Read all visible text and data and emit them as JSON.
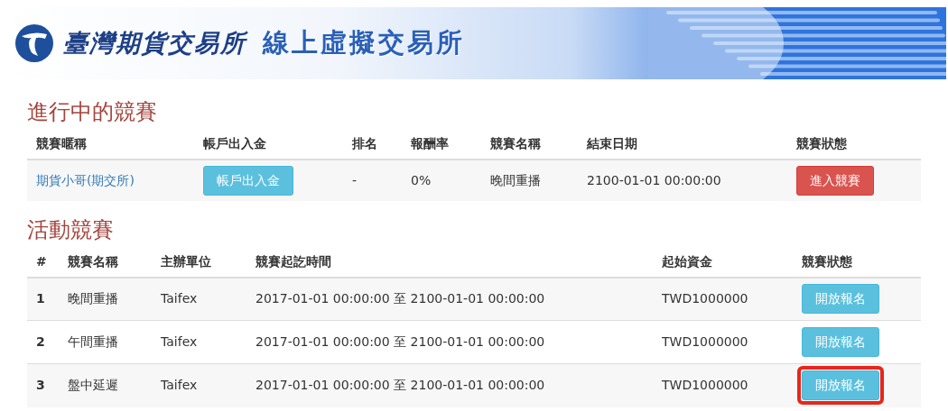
{
  "banner": {
    "logo_text": "臺灣期貨交易所",
    "title": "線上虛擬交易所"
  },
  "current": {
    "heading": "進行中的競賽",
    "columns": [
      "競賽暱稱",
      "帳戶出入金",
      "排名",
      "報酬率",
      "競賽名稱",
      "結束日期",
      "競賽狀態"
    ],
    "rows": [
      {
        "nickname": "期貨小哥(期交所)",
        "funds_button": "帳戶出入金",
        "rank": "-",
        "return": "0%",
        "name": "晚間重播",
        "end": "2100-01-01 00:00:00",
        "status_button": "進入競賽"
      }
    ]
  },
  "activities": {
    "heading": "活動競賽",
    "columns": [
      "#",
      "競賽名稱",
      "主辦單位",
      "競賽起訖時間",
      "起始資金",
      "競賽狀態"
    ],
    "rows": [
      {
        "no": "1",
        "name": "晚間重播",
        "organizer": "Taifex",
        "period": "2017-01-01 00:00:00 至 2100-01-01 00:00:00",
        "capital": "TWD1000000",
        "status_button": "開放報名",
        "highlighted": false
      },
      {
        "no": "2",
        "name": "午間重播",
        "organizer": "Taifex",
        "period": "2017-01-01 00:00:00 至 2100-01-01 00:00:00",
        "capital": "TWD1000000",
        "status_button": "開放報名",
        "highlighted": false
      },
      {
        "no": "3",
        "name": "盤中延遲",
        "organizer": "Taifex",
        "period": "2017-01-01 00:00:00 至 2100-01-01 00:00:00",
        "capital": "TWD1000000",
        "status_button": "開放報名",
        "highlighted": true
      }
    ]
  }
}
